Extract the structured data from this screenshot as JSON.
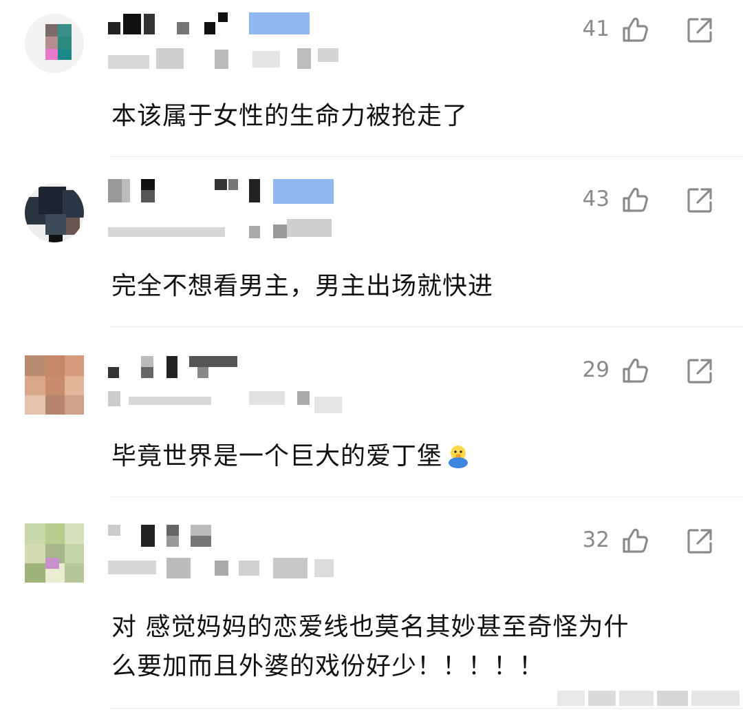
{
  "comments": [
    {
      "likes": "41",
      "text": "本该属于女性的生命力被抢走了"
    },
    {
      "likes": "43",
      "text": "完全不想看男主，男主出场就快进"
    },
    {
      "likes": "29",
      "text": "毕竟世界是一个巨大的爱丁堡"
    },
    {
      "likes": "32",
      "text_line1": "对 感觉妈妈的恋爱线也莫名其妙甚至奇怪为什",
      "text_line2": "么要加而且外婆的戏份好少！！！！！"
    }
  ],
  "icons": {
    "like": "thumbs-up-icon",
    "share": "share-external-icon",
    "emoji": "chick-emoji-icon"
  },
  "colors": {
    "count": "#8a8a8a",
    "text": "#111111",
    "divider": "#ececec",
    "blur_blue": "#8fb8f0"
  }
}
